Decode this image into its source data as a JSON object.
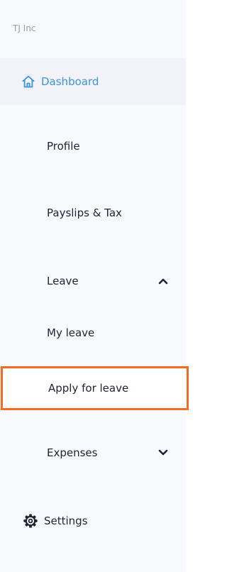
{
  "sidebar": {
    "org_name": "TJ Inc",
    "accent_color": "#3d94d9",
    "highlight_color": "#f26a23",
    "items": [
      {
        "label": "Dashboard",
        "icon": "home-icon",
        "active": true
      },
      {
        "label": "Profile"
      },
      {
        "label": "Payslips & Tax"
      },
      {
        "label": "Leave",
        "expanded": true,
        "icon": "chevron-up-icon"
      },
      {
        "label": "My leave"
      },
      {
        "label": "Apply for leave",
        "highlighted": true
      },
      {
        "label": "Expenses",
        "expanded": false,
        "icon": "chevron-down-icon"
      },
      {
        "label": "Settings",
        "icon": "gear-icon"
      }
    ]
  }
}
